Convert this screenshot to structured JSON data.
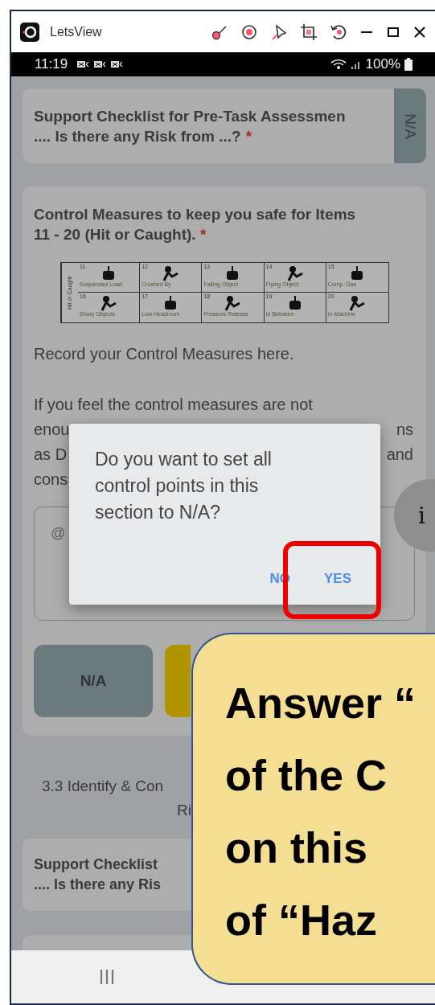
{
  "window": {
    "title": "LetsView"
  },
  "status_bar": {
    "time": "11:19",
    "battery": "100%"
  },
  "checklist_top": {
    "title_lines": [
      "Support Checklist for Pre-Task Assessmen",
      ".... Is there any Risk from ...?"
    ],
    "required_mark": "*",
    "side_tab": "N/A"
  },
  "control_card": {
    "title": "Control Measures to keep you safe for Items 11 - 20 (Hit or Caught).",
    "required_mark": "*",
    "hazard_table": {
      "row_label": "Hit or Caught",
      "cells": [
        {
          "number": "11",
          "label": "Suspended Load"
        },
        {
          "number": "12",
          "label": "Crushed By"
        },
        {
          "number": "13",
          "label": "Falling Object"
        },
        {
          "number": "14",
          "label": "Flying Object"
        },
        {
          "number": "15",
          "label": "Comp. Gas"
        },
        {
          "number": "16",
          "label": "Sharp Objects"
        },
        {
          "number": "17",
          "label": "Low Headroom"
        },
        {
          "number": "18",
          "label": "Pressure Release"
        },
        {
          "number": "19",
          "label": "In Between"
        },
        {
          "number": "20",
          "label": "In Machine"
        }
      ]
    },
    "instruction": "Record your Control Measures here.",
    "note": {
      "first_line": "If you feel the control measures are not",
      "fragments": [
        {
          "left": "enou",
          "right": "ns"
        },
        {
          "left": "as D",
          "right": "and"
        },
        {
          "left": "cons"
        }
      ]
    },
    "comment_field": {
      "placeholder": "@"
    },
    "answer_buttons": [
      {
        "kind": "na",
        "label": "N/A"
      },
      {
        "kind": "warning"
      }
    ]
  },
  "section": {
    "title": "3.3 Identify & Con",
    "title_end": "Ri"
  },
  "checklist_bottom": {
    "title_lines": [
      "Support Checklist",
      ".... Is there any Ris"
    ]
  },
  "info_button": {
    "label": "i"
  },
  "dialog": {
    "message": "Do you want to set all control points in this section to N/A?",
    "buttons": [
      {
        "label": "NO",
        "highlighted": false
      },
      {
        "label": "YES",
        "highlighted": true
      }
    ]
  },
  "callout": {
    "lines": [
      "Answer “",
      "of the C",
      "on this",
      "of “Haz"
    ]
  }
}
